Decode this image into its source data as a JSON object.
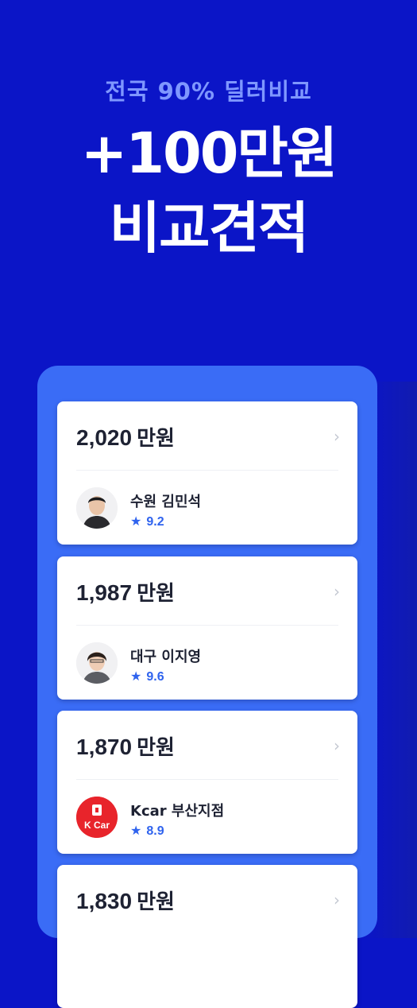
{
  "hero": {
    "subtitle": "전국  90% 딜러비교",
    "title_line1": "+100만원",
    "title_line2": "비교견적"
  },
  "offers": [
    {
      "price": "2,020",
      "unit": "만원",
      "dealer": "수원 김민석",
      "rating": "9.2",
      "avatar": "person"
    },
    {
      "price": "1,987",
      "unit": "만원",
      "dealer": "대구 이지영",
      "rating": "9.6",
      "avatar": "person"
    },
    {
      "price": "1,870",
      "unit": "만원",
      "dealer": "Kcar 부산지점",
      "rating": "8.9",
      "avatar": "kcar-logo"
    },
    {
      "price": "1,830",
      "unit": "만원",
      "dealer": "",
      "rating": "",
      "avatar": ""
    }
  ],
  "logo": {
    "kcar_text": "K Car"
  },
  "colors": {
    "background": "#0b15c7",
    "panel": "#3a6cf6",
    "accent": "#2f63ee",
    "subtitle": "#7f97ff"
  }
}
